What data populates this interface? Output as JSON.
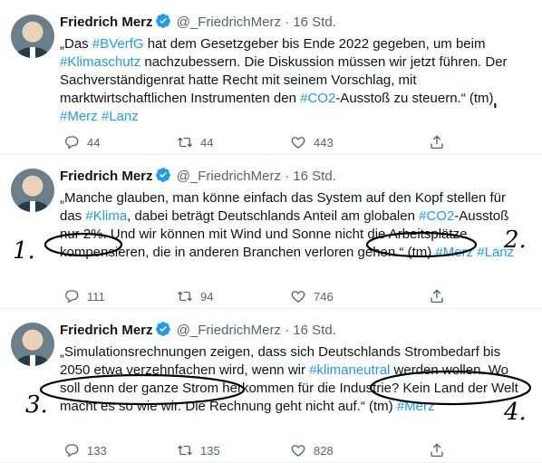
{
  "tweets": [
    {
      "name": "Friedrich Merz",
      "handle": "@_FriedrichMerz",
      "sep": "·",
      "time": "16 Std.",
      "lines": [
        [
          {
            "t": "„Das "
          },
          {
            "t": "#BVerfG",
            "tag": true
          },
          {
            "t": " hat dem Gesetzgeber bis Ende 2022 gegeben, um beim"
          }
        ],
        [
          {
            "t": "#Klimaschutz",
            "tag": true
          },
          {
            "t": " nachzubessern. Die Diskussion müssen wir jetzt führen. Der"
          }
        ],
        [
          {
            "t": "Sachverständigenrat hatte Recht mit seinem Vorschlag, mit"
          }
        ],
        [
          {
            "t": "marktwirtschaftlichen Instrumenten den "
          },
          {
            "t": "#CO2",
            "tag": true
          },
          {
            "t": "-Ausstoß zu steuern.“ (tm)"
          }
        ],
        [
          {
            "t": "#Merz",
            "tag": true
          },
          {
            "t": " "
          },
          {
            "t": "#Lanz",
            "tag": true
          }
        ]
      ],
      "replies": "44",
      "retweets": "44",
      "likes": "443"
    },
    {
      "name": "Friedrich Merz",
      "handle": "@_FriedrichMerz",
      "sep": "·",
      "time": "16 Std.",
      "lines": [
        [
          {
            "t": "„Manche glauben, man könne einfach das System auf den Kopf stellen für"
          }
        ],
        [
          {
            "t": "das "
          },
          {
            "t": "#Klima",
            "tag": true
          },
          {
            "t": ", dabei beträgt Deutschlands Anteil am globalen "
          },
          {
            "t": "#CO2",
            "tag": true
          },
          {
            "t": "-Ausstoß"
          }
        ],
        [
          {
            "t": "nur 2%. Und wir können mit Wind und Sonne nicht die Arbeitsplätze"
          }
        ],
        [
          {
            "t": "kompensieren, die in anderen Branchen verloren gehen.“ (tm) "
          },
          {
            "t": "#Merz",
            "tag": true
          },
          {
            "t": " "
          },
          {
            "t": "#Lanz",
            "tag": true
          }
        ]
      ],
      "replies": "111",
      "retweets": "94",
      "likes": "746"
    },
    {
      "name": "Friedrich Merz",
      "handle": "@_FriedrichMerz",
      "sep": "·",
      "time": "16 Std.",
      "lines": [
        [
          {
            "t": "„Simulationsrechnungen zeigen, dass sich Deutschlands Strombedarf bis"
          }
        ],
        [
          {
            "t": "2050 etwa verzehnfachen wird, wenn wir "
          },
          {
            "t": "#klimaneutral",
            "tag": true
          },
          {
            "t": " werden wollen. Wo"
          }
        ],
        [
          {
            "t": "soll denn der ganze Strom herkommen für die Industrie? Kein Land der Welt"
          }
        ],
        [
          {
            "t": "macht es so wie wir. Die Rechnung geht nicht auf.“ (tm) "
          },
          {
            "t": "#Merz",
            "tag": true
          }
        ]
      ],
      "replies": "133",
      "retweets": "135",
      "likes": "828"
    }
  ],
  "annotations": [
    "1.",
    "2.",
    "3.",
    "4."
  ],
  "colors": {
    "text": "#0f1419",
    "muted": "#536471",
    "accent": "#1d9bf0"
  }
}
